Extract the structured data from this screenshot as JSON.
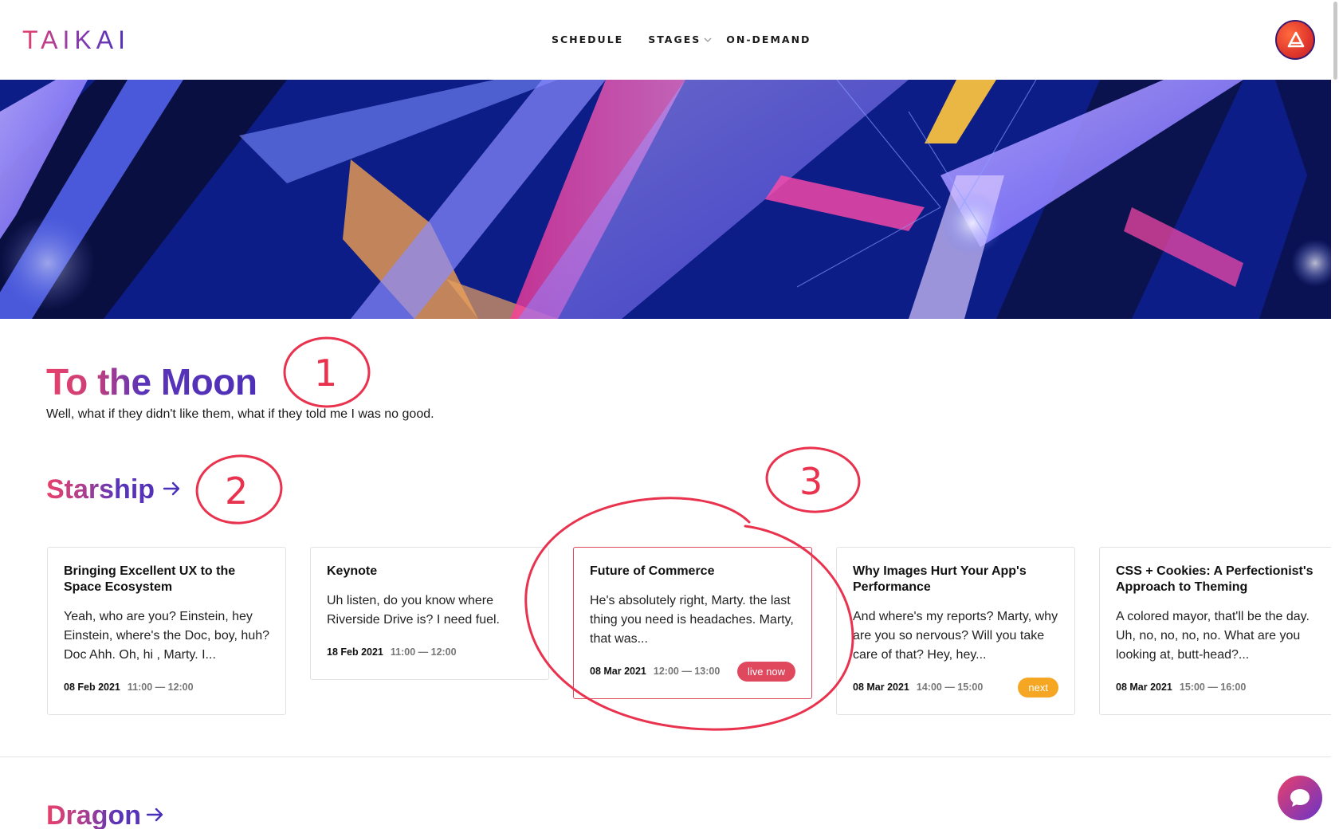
{
  "brand": {
    "name": "TAIKAI"
  },
  "nav": {
    "schedule": "SCHEDULE",
    "stages": "STAGES",
    "on_demand": "ON-DEMAND"
  },
  "event": {
    "title": "To the Moon",
    "subtitle": "Well, what if they didn't like them, what if they told me I was no good."
  },
  "stages": [
    {
      "name": "Starship",
      "sessions": [
        {
          "title": "Bringing Excellent UX to the Space Ecosystem",
          "description": "Yeah, who are you? Einstein, hey Einstein, where's the Doc, boy, huh? Doc Ahh. Oh, hi , Marty. I...",
          "date": "08 Feb 2021",
          "time": "11:00 — 12:00",
          "badge": ""
        },
        {
          "title": "Keynote",
          "description": "Uh listen, do you know where Riverside Drive is? I need fuel.",
          "date": "18 Feb 2021",
          "time": "11:00 — 12:00",
          "badge": ""
        },
        {
          "title": "Future of Commerce",
          "description": "He's absolutely right, Marty. the last thing you need is headaches. Marty, that was...",
          "date": "08 Mar 2021",
          "time": "12:00 — 13:00",
          "badge": "live now"
        },
        {
          "title": "Why Images Hurt Your App's Performance",
          "description": "And where's my reports? Marty, why are you so nervous? Will you take care of that? Hey, hey...",
          "date": "08 Mar 2021",
          "time": "14:00 — 15:00",
          "badge": "next"
        },
        {
          "title": "CSS + Cookies: A Perfectionist's Approach to Theming",
          "description": "A colored mayor, that'll be the day. Uh, no, no, no, no. What are you looking at, butt-head?...",
          "date": "08 Mar 2021",
          "time": "15:00 — 16:00",
          "badge": ""
        }
      ]
    },
    {
      "name": "Dragon",
      "sessions": []
    }
  ],
  "annotations": [
    "1",
    "2",
    "3"
  ],
  "colors": {
    "accent_pink": "#e8406a",
    "accent_purple": "#4a2fb8",
    "live": "#e0485e",
    "next": "#f5a623",
    "annotation_red": "#e8324e"
  }
}
